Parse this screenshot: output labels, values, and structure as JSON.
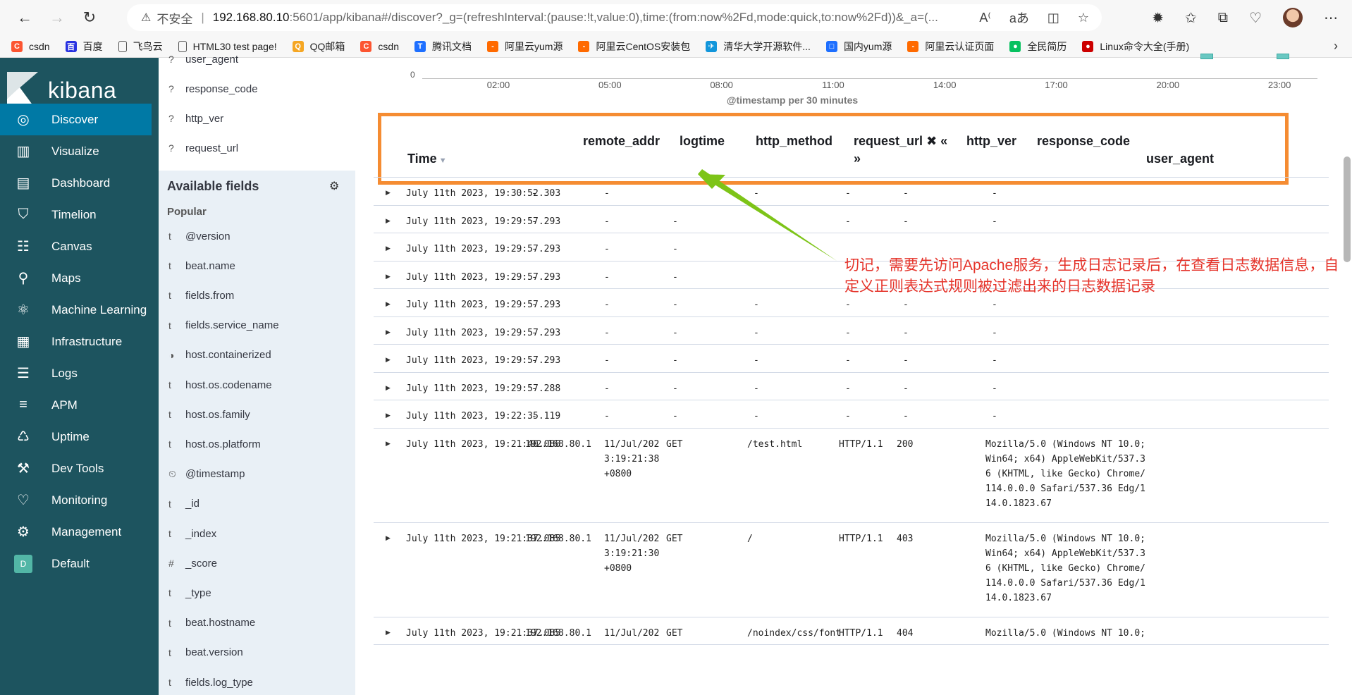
{
  "browser": {
    "insecure_label": "不安全",
    "url_host": "192.168.80.10",
    "url_rest": ":5601/app/kibana#/discover?_g=(refreshInterval:(pause:!t,value:0),time:(from:now%2Fd,mode:quick,to:now%2Fd))&_a=(..."
  },
  "bookmarks": [
    {
      "label": "csdn",
      "color": "#fc5531",
      "icon": "C"
    },
    {
      "label": "百度",
      "color": "#2932e1",
      "icon": "百"
    },
    {
      "label": "飞鸟云",
      "color": "#555555",
      "icon": ""
    },
    {
      "label": "HTML30 test page!",
      "color": "#555555",
      "icon": ""
    },
    {
      "label": "QQ邮箱",
      "color": "#f5a623",
      "icon": "Q"
    },
    {
      "label": "csdn",
      "color": "#fc5531",
      "icon": "C"
    },
    {
      "label": "腾讯文档",
      "color": "#1e6fff",
      "icon": "T"
    },
    {
      "label": "阿里云yum源",
      "color": "#ff6a00",
      "icon": "[-]"
    },
    {
      "label": "阿里云CentOS安装包",
      "color": "#ff6a00",
      "icon": "[-]"
    },
    {
      "label": "清华大学开源软件...",
      "color": "#1296db",
      "icon": "✈"
    },
    {
      "label": "国内yum源",
      "color": "#1e6fff",
      "icon": "□"
    },
    {
      "label": "阿里云认证页面",
      "color": "#ff6a00",
      "icon": "[-]"
    },
    {
      "label": "全民简历",
      "color": "#07c160",
      "icon": "●"
    },
    {
      "label": "Linux命令大全(手册)",
      "color": "#cc0000",
      "icon": "●"
    }
  ],
  "kibana": {
    "logo": "kibana",
    "nav": [
      {
        "label": "Discover",
        "active": true
      },
      {
        "label": "Visualize"
      },
      {
        "label": "Dashboard"
      },
      {
        "label": "Timelion"
      },
      {
        "label": "Canvas"
      },
      {
        "label": "Maps"
      },
      {
        "label": "Machine Learning"
      },
      {
        "label": "Infrastructure"
      },
      {
        "label": "Logs"
      },
      {
        "label": "APM"
      },
      {
        "label": "Uptime"
      },
      {
        "label": "Dev Tools"
      },
      {
        "label": "Monitoring"
      },
      {
        "label": "Management"
      },
      {
        "label": "Default"
      }
    ]
  },
  "fields": {
    "selected": [
      {
        "type": "?",
        "name": "user_agent"
      },
      {
        "type": "?",
        "name": "response_code"
      },
      {
        "type": "?",
        "name": "http_ver"
      },
      {
        "type": "?",
        "name": "request_url"
      }
    ],
    "available_title": "Available fields",
    "popular_title": "Popular",
    "available": [
      {
        "type": "t",
        "name": "@version"
      },
      {
        "type": "t",
        "name": "beat.name"
      },
      {
        "type": "t",
        "name": "fields.from"
      },
      {
        "type": "t",
        "name": "fields.service_name"
      },
      {
        "type": "◑",
        "name": "host.containerized"
      },
      {
        "type": "t",
        "name": "host.os.codename"
      },
      {
        "type": "t",
        "name": "host.os.family"
      },
      {
        "type": "t",
        "name": "host.os.platform"
      },
      {
        "type": "⏲",
        "name": "@timestamp"
      },
      {
        "type": "t",
        "name": "_id"
      },
      {
        "type": "t",
        "name": "_index"
      },
      {
        "type": "#",
        "name": "_score"
      },
      {
        "type": "t",
        "name": "_type"
      },
      {
        "type": "t",
        "name": "beat.hostname"
      },
      {
        "type": "t",
        "name": "beat.version"
      },
      {
        "type": "t",
        "name": "fields.log_type"
      }
    ]
  },
  "histogram": {
    "zero": "0",
    "ticks": [
      "02:00",
      "05:00",
      "08:00",
      "11:00",
      "14:00",
      "17:00",
      "20:00",
      "23:00"
    ],
    "axis_title": "@timestamp per 30 minutes"
  },
  "table": {
    "headers": {
      "time": "Time",
      "remote_addr": "remote_addr",
      "logtime": "logtime",
      "http_method": "http_method",
      "request_url": "request_url",
      "request_url_controls_1": "✖ «",
      "request_url_controls_2": "»",
      "http_ver": "http_ver",
      "response_code": "response_code",
      "user_agent": "user_agent"
    },
    "rows": [
      {
        "time": "July 11th 2023, 19:30:52.303",
        "remote_addr": "-",
        "logtime": "-",
        "http_method": "",
        "request_url": "-",
        "http_ver": "-",
        "response_code": "-",
        "user_agent": "-"
      },
      {
        "time": "July 11th 2023, 19:29:57.293",
        "remote_addr": "-",
        "logtime": "-",
        "http_method": "-",
        "request_url": "",
        "http_ver": "-",
        "response_code": "-",
        "user_agent": "-"
      },
      {
        "time": "July 11th 2023, 19:29:57.293",
        "remote_addr": "-",
        "logtime": "-",
        "http_method": "-",
        "request_url": "",
        "http_ver": "",
        "response_code": "",
        "user_agent": ""
      },
      {
        "time": "July 11th 2023, 19:29:57.293",
        "remote_addr": "-",
        "logtime": "-",
        "http_method": "-",
        "request_url": "",
        "http_ver": "",
        "response_code": "",
        "user_agent": ""
      },
      {
        "time": "July 11th 2023, 19:29:57.293",
        "remote_addr": "-",
        "logtime": "-",
        "http_method": "-",
        "request_url": "-",
        "http_ver": "-",
        "response_code": "-",
        "user_agent": "-"
      },
      {
        "time": "July 11th 2023, 19:29:57.293",
        "remote_addr": "-",
        "logtime": "-",
        "http_method": "-",
        "request_url": "-",
        "http_ver": "-",
        "response_code": "-",
        "user_agent": "-"
      },
      {
        "time": "July 11th 2023, 19:29:57.293",
        "remote_addr": "-",
        "logtime": "-",
        "http_method": "-",
        "request_url": "-",
        "http_ver": "-",
        "response_code": "-",
        "user_agent": "-"
      },
      {
        "time": "July 11th 2023, 19:29:57.288",
        "remote_addr": "-",
        "logtime": "-",
        "http_method": "-",
        "request_url": "-",
        "http_ver": "-",
        "response_code": "-",
        "user_agent": "-"
      },
      {
        "time": "July 11th 2023, 19:22:35.119",
        "remote_addr": "-",
        "logtime": "-",
        "http_method": "-",
        "request_url": "-",
        "http_ver": "-",
        "response_code": "-",
        "user_agent": "-"
      },
      {
        "time": "July 11th 2023, 19:21:40.086",
        "remote_addr": "192.168.80.1",
        "logtime": "11/Jul/202\n3:19:21:38\n+0800",
        "http_method": "GET",
        "request_url": "/test.html",
        "http_ver": "HTTP/1.1",
        "response_code": "200",
        "user_agent": "Mozilla/5.0 (Windows NT 10.0;\nWin64; x64) AppleWebKit/537.3\n6 (KHTML, like Gecko) Chrome/\n114.0.0.0 Safari/537.36 Edg/1\n14.0.1823.67"
      },
      {
        "time": "July 11th 2023, 19:21:37.085",
        "remote_addr": "192.168.80.1",
        "logtime": "11/Jul/202\n3:19:21:30\n+0800",
        "http_method": "GET",
        "request_url": "/",
        "http_ver": "HTTP/1.1",
        "response_code": "403",
        "user_agent": "Mozilla/5.0 (Windows NT 10.0;\nWin64; x64) AppleWebKit/537.3\n6 (KHTML, like Gecko) Chrome/\n114.0.0.0 Safari/537.36 Edg/1\n14.0.1823.67"
      },
      {
        "time": "July 11th 2023, 19:21:37.085",
        "remote_addr": "192.168.80.1",
        "logtime": "11/Jul/202",
        "http_method": "GET",
        "request_url": "/noindex/css/font",
        "http_ver": "HTTP/1.1",
        "response_code": "404",
        "user_agent": "Mozilla/5.0 (Windows NT 10.0;"
      }
    ]
  },
  "annotation": {
    "text": "切记，需要先访问Apache服务，生成日志记录后，在查看日志数据信息，自定义正则表达式规则被过滤出来的日志数据记录",
    "color": "#e5332a",
    "box_color": "#f58c32",
    "arrow_color": "#7dc418"
  }
}
